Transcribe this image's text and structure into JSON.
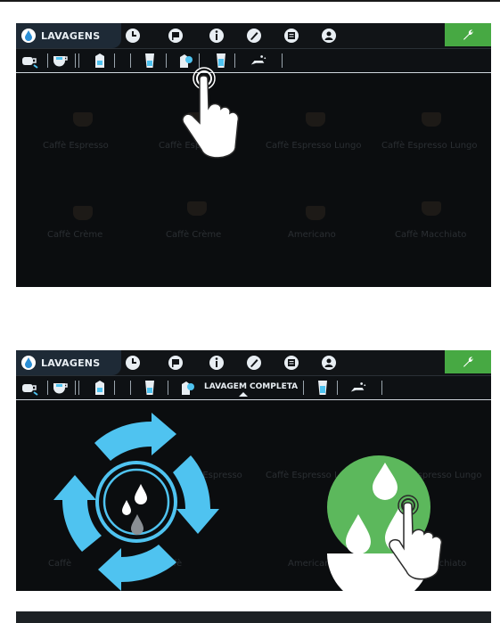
{
  "screens": [
    {
      "topbar": {
        "active_tab": "LAVAGENS",
        "icons": [
          "clock-icon",
          "flag-icon",
          "info-icon",
          "pencil-icon",
          "ticket-icon",
          "barista-icon"
        ],
        "service_icon": "wrench-icon"
      },
      "subbar": {
        "icons": [
          "coffee-rinse-icon",
          "cup-icon",
          "milk-carton-icon",
          "glass-icon",
          "milk-clean-icon",
          "glass-blue-icon",
          "hand-wash-icon"
        ]
      },
      "background_items": {
        "row1": [
          "Caffè Espresso",
          "Caffè Espresso",
          "Caffè Espresso Lungo",
          "Caffè Espresso Lungo"
        ],
        "row2": [
          "Caffè Crème",
          "Caffè Crème",
          "Americano",
          "Caffè Macchiato"
        ]
      }
    },
    {
      "topbar": {
        "active_tab": "LAVAGENS",
        "icons": [
          "clock-icon",
          "flag-icon",
          "info-icon",
          "pencil-icon",
          "ticket-icon",
          "barista-icon"
        ],
        "service_icon": "wrench-icon"
      },
      "subbar": {
        "icons": [
          "coffee-rinse-icon",
          "cup-icon",
          "milk-carton-icon",
          "glass-icon",
          "milk-clean-icon",
          "glass-blue-icon",
          "hand-wash-icon"
        ],
        "active_label": "LAVAGEM COMPLETA"
      },
      "background_items": {
        "row1": [
          "",
          "Caffè Espresso",
          "Caffè Espresso Lungo",
          "Caffè Espresso Lungo"
        ],
        "row2": [
          "Caffè",
          "Caffè",
          "Americano",
          "Caffè Macchiato"
        ]
      }
    }
  ],
  "colors": {
    "accent": "#4fc3f0",
    "confirm": "#5cb85c",
    "service": "#47a943",
    "bar": "#111417"
  }
}
